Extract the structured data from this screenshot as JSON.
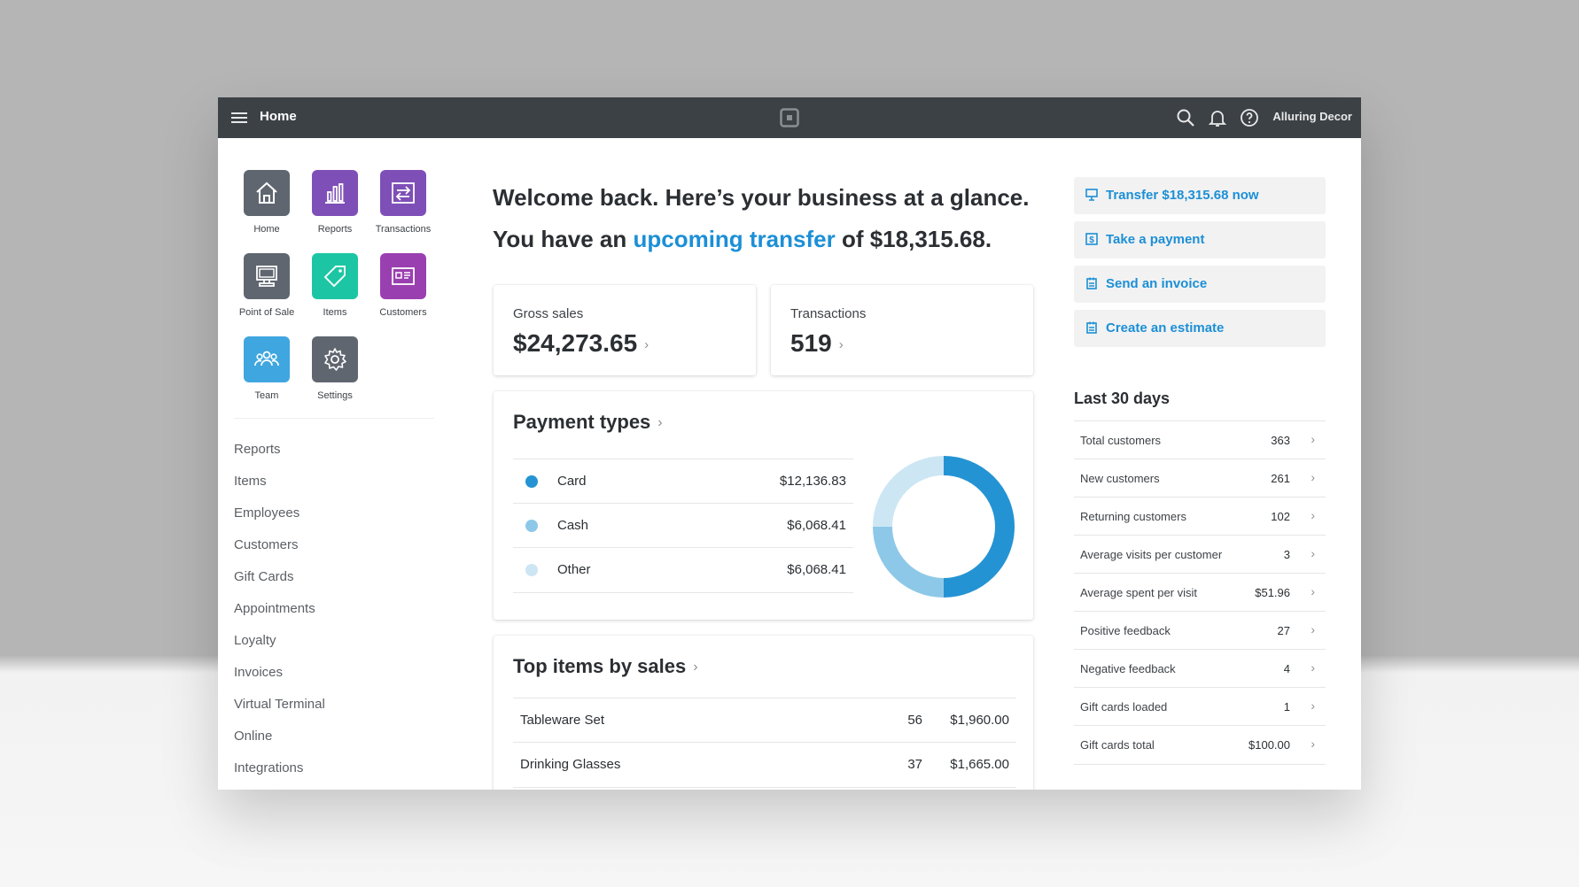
{
  "topbar": {
    "title": "Home",
    "account": "Alluring Decor",
    "icons": [
      "menu-icon",
      "square-logo-icon",
      "search-icon",
      "bell-icon",
      "help-icon"
    ]
  },
  "apps": [
    {
      "label": "Home",
      "icon": "home-icon",
      "color": "#5f6670"
    },
    {
      "label": "Reports",
      "icon": "bar-chart-icon",
      "color": "#7f4fb8"
    },
    {
      "label": "Transactions",
      "icon": "transfer-icon",
      "color": "#7f4fb8"
    },
    {
      "label": "Point of Sale",
      "icon": "register-icon",
      "color": "#5f6670"
    },
    {
      "label": "Items",
      "icon": "tag-icon",
      "color": "#1cc6a4"
    },
    {
      "label": "Customers",
      "icon": "contact-card-icon",
      "color": "#9a3fb0"
    },
    {
      "label": "Team",
      "icon": "team-icon",
      "color": "#3fa6e0"
    },
    {
      "label": "Settings",
      "icon": "gear-icon",
      "color": "#5f6670"
    }
  ],
  "sidebar_links": [
    "Reports",
    "Items",
    "Employees",
    "Customers",
    "Gift Cards",
    "Appointments",
    "Loyalty",
    "Invoices",
    "Virtual Terminal",
    "Online",
    "Integrations"
  ],
  "welcome": {
    "line1": "Welcome back. Here’s your business at a glance.",
    "line2_prefix": "You have an",
    "line2_link": "upcoming transfer",
    "line2_suffix": "of $18,315.68."
  },
  "stats": {
    "gross_sales_label": "Gross sales",
    "gross_sales_value": "$24,273.65",
    "transactions_label": "Transactions",
    "transactions_value": "519"
  },
  "payment_types": {
    "title": "Payment types",
    "rows": [
      {
        "name": "Card",
        "amount": "$12,136.83",
        "color": "#2493d3"
      },
      {
        "name": "Cash",
        "amount": "$6,068.41",
        "color": "#8ec8e8"
      },
      {
        "name": "Other",
        "amount": "$6,068.41",
        "color": "#cde6f4"
      }
    ],
    "donut_values": [
      12136.83,
      6068.41,
      6068.41
    ]
  },
  "top_items": {
    "title": "Top items by sales",
    "rows": [
      {
        "name": "Tableware Set",
        "qty": "56",
        "amount": "$1,960.00"
      },
      {
        "name": "Drinking Glasses",
        "qty": "37",
        "amount": "$1,665.00"
      }
    ]
  },
  "actions": [
    {
      "label": "Transfer $18,315.68 now",
      "icon": "transfer-icon"
    },
    {
      "label": "Take a payment",
      "icon": "payment-icon"
    },
    {
      "label": "Send an invoice",
      "icon": "invoice-icon"
    },
    {
      "label": "Create an estimate",
      "icon": "estimate-icon"
    }
  ],
  "last30": {
    "title": "Last 30 days",
    "rows": [
      {
        "label": "Total customers",
        "value": "363"
      },
      {
        "label": "New customers",
        "value": "261"
      },
      {
        "label": "Returning customers",
        "value": "102"
      },
      {
        "label": "Average visits per customer",
        "value": "3"
      },
      {
        "label": "Average spent per visit",
        "value": "$51.96"
      },
      {
        "label": "Positive feedback",
        "value": "27"
      },
      {
        "label": "Negative feedback",
        "value": "4"
      },
      {
        "label": "Gift cards loaded",
        "value": "1"
      },
      {
        "label": "Gift cards total",
        "value": "$100.00"
      }
    ]
  },
  "colors": {
    "accent": "#1c8fd6",
    "topbar": "#3c4146"
  }
}
